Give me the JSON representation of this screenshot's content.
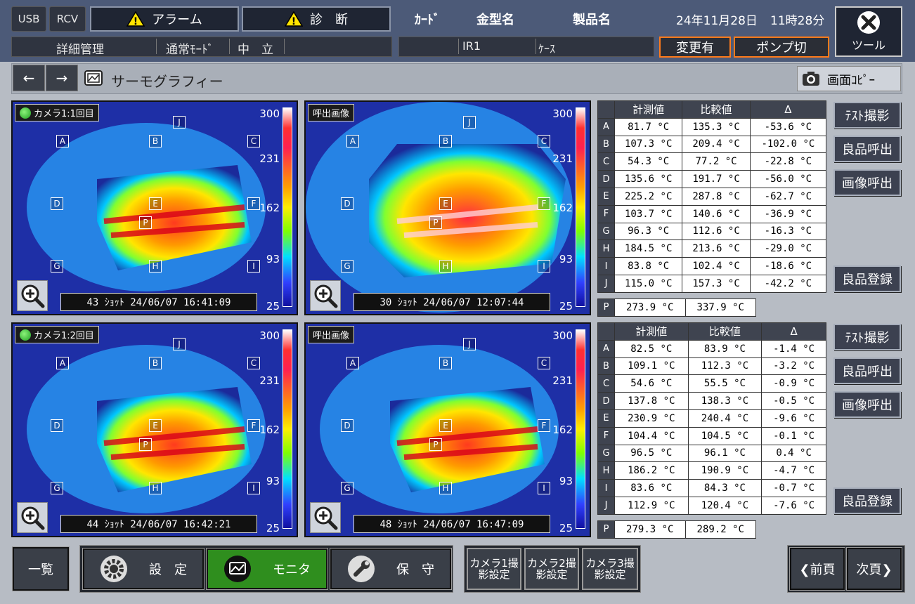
{
  "top": {
    "usb": "USB",
    "rcv": "RCV",
    "alarm": "アラーム",
    "diag": "診　断",
    "card": "ｶｰﾄﾞ",
    "mold": "金型名",
    "product": "製品名",
    "date": "24年11月28日",
    "time": "11時28分",
    "tool": "ツール",
    "detail": "詳細管理",
    "mode": "通常ﾓｰﾄﾞ",
    "neutral": "中　立",
    "ir": "IR1",
    "case": "ｹｰｽ",
    "change": "変更有",
    "pump": "ポンプ切"
  },
  "nav": {
    "back": "←",
    "forward": "→",
    "title": "サーモグラフィー",
    "copy": "画面ｺﾋﾟｰ"
  },
  "scale": [
    "300",
    "231",
    "162",
    "93",
    "25"
  ],
  "points": [
    "A",
    "B",
    "C",
    "D",
    "E",
    "F",
    "G",
    "H",
    "I",
    "J",
    "P"
  ],
  "panels": [
    {
      "tag": "カメラ1:1回目",
      "shot": "43 ｼｮｯﾄ 24/06/07 16:41:09"
    },
    {
      "tag": "呼出画像",
      "shot": "30 ｼｮｯﾄ 24/06/07 12:07:44"
    },
    {
      "tag": "カメラ1:2回目",
      "shot": "44 ｼｮｯﾄ 24/06/07 16:42:21"
    },
    {
      "tag": "呼出画像",
      "shot": "48 ｼｮｯﾄ 24/06/07 16:47:09"
    }
  ],
  "headers": [
    "計測値",
    "比較値",
    "Δ"
  ],
  "table1": {
    "rows": [
      [
        "A",
        "81.7 °C",
        "135.3 °C",
        "-53.6 °C"
      ],
      [
        "B",
        "107.3 °C",
        "209.4 °C",
        "-102.0 °C"
      ],
      [
        "C",
        "54.3 °C",
        "77.2 °C",
        "-22.8 °C"
      ],
      [
        "D",
        "135.6 °C",
        "191.7 °C",
        "-56.0 °C"
      ],
      [
        "E",
        "225.2 °C",
        "287.8 °C",
        "-62.7 °C"
      ],
      [
        "F",
        "103.7 °C",
        "140.6 °C",
        "-36.9 °C"
      ],
      [
        "G",
        "96.3 °C",
        "112.6 °C",
        "-16.3 °C"
      ],
      [
        "H",
        "184.5 °C",
        "213.6 °C",
        "-29.0 °C"
      ],
      [
        "I",
        "83.8 °C",
        "102.4 °C",
        "-18.6 °C"
      ],
      [
        "J",
        "115.0 °C",
        "157.3 °C",
        "-42.2 °C"
      ]
    ],
    "p": [
      "P",
      "273.9 °C",
      "337.9 °C"
    ]
  },
  "table2": {
    "rows": [
      [
        "A",
        "82.5 °C",
        "83.9 °C",
        "-1.4 °C"
      ],
      [
        "B",
        "109.1 °C",
        "112.3 °C",
        "-3.2 °C"
      ],
      [
        "C",
        "54.6 °C",
        "55.5 °C",
        "-0.9 °C"
      ],
      [
        "D",
        "137.8 °C",
        "138.3 °C",
        "-0.5 °C"
      ],
      [
        "E",
        "230.9 °C",
        "240.4 °C",
        "-9.6 °C"
      ],
      [
        "F",
        "104.4 °C",
        "104.5 °C",
        "-0.1 °C"
      ],
      [
        "G",
        "96.5 °C",
        "96.1 °C",
        "0.4 °C"
      ],
      [
        "H",
        "186.2 °C",
        "190.9 °C",
        "-4.7 °C"
      ],
      [
        "I",
        "83.6 °C",
        "84.3 °C",
        "-0.7 °C"
      ],
      [
        "J",
        "112.9 °C",
        "120.4 °C",
        "-7.6 °C"
      ]
    ],
    "p": [
      "P",
      "279.3 °C",
      "289.2 °C"
    ]
  },
  "side": {
    "test": "ﾃｽﾄ撮影",
    "good_call": "良品呼出",
    "img_call": "画像呼出",
    "good_reg": "良品登録"
  },
  "bottom": {
    "list": "一覧",
    "settings": "設　定",
    "monitor": "モニタ",
    "maint": "保　守",
    "cam1": "カメラ1撮影設定",
    "cam2": "カメラ2撮影設定",
    "cam3": "カメラ3撮影設定",
    "prev": "❮前頁",
    "next": "次頁❯"
  }
}
